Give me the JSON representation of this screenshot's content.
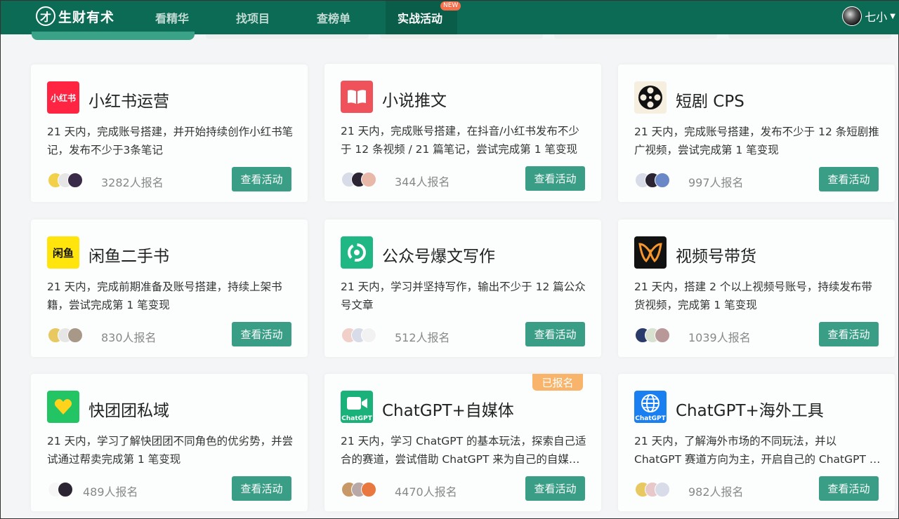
{
  "nav": {
    "logo_text": "生财有术",
    "logo_glyph": "才",
    "items": [
      "看精华",
      "找项目",
      "查榜单",
      "实战活动"
    ],
    "new_badge": "NEW",
    "user_name": "七小"
  },
  "colors": {
    "nav_bg": "#0c6b55",
    "button": "#3a9e86",
    "enrolled_badge": "#f7b46a"
  },
  "cards": [
    {
      "icon": "xiaohongshu-icon",
      "icon_text": "小红书",
      "title": "小红书运营",
      "desc": "21 天内，完成账号搭建，并开始持续创作小红书笔记，发布不少于3条笔记",
      "count": "3282人报名",
      "button": "查看活动"
    },
    {
      "icon": "book-icon",
      "title": "小说推文",
      "desc": "21 天内，完成账号搭建，在抖音/小红书发布不少于 12 条视频 / 21 篇笔记，尝试完成第 1 笔变现",
      "count": "344人报名",
      "button": "查看活动"
    },
    {
      "icon": "film-reel-icon",
      "title": "短剧 CPS",
      "desc": "21 天内，完成账号搭建，发布不少于 12 条短剧推广视频，尝试完成第 1 笔变现",
      "count": "997人报名",
      "button": "查看活动"
    },
    {
      "icon": "xianyu-icon",
      "icon_text": "闲鱼",
      "title": "闲鱼二手书",
      "desc": "21 天内，完成前期准备及账号搭建，持续上架书籍，尝试完成第 1 笔变现",
      "count": "830人报名",
      "button": "查看活动"
    },
    {
      "icon": "wechat-official-icon",
      "title": "公众号爆文写作",
      "desc": "21 天内，学习并坚持写作，输出不少于 12 篇公众号文章",
      "count": "512人报名",
      "button": "查看活动"
    },
    {
      "icon": "wechat-channels-icon",
      "title": "视频号带货",
      "desc": "21 天内，搭建 2 个以上视频号账号，持续发布带货视频，完成第 1 笔变现",
      "count": "1039人报名",
      "button": "查看活动"
    },
    {
      "icon": "kuaituantuan-icon",
      "title": "快团团私域",
      "desc": "21 天内，学习了解快团团不同角色的优劣势，并尝试通过帮卖完成第 1 笔变现",
      "count": "489人报名",
      "button": "查看活动"
    },
    {
      "icon": "chatgpt-video-icon",
      "icon_text": "ChatGPT",
      "title": "ChatGPT+自媒体",
      "desc": "21 天内，学习 ChatGPT 的基本玩法，探索自己适合的赛道，尝试借助 ChatGPT 来为自己的自媒体赋能",
      "count": "4470人报名",
      "button": "查看活动",
      "badge": "已报名"
    },
    {
      "icon": "chatgpt-globe-icon",
      "icon_text": "ChatGPT",
      "title": "ChatGPT+海外工具",
      "desc": "21 天内，了解海外市场的不同玩法，并以 ChatGPT 赛道方向为主，开启自己的 ChatGPT 海外之路",
      "count": "982人报名",
      "button": "查看活动"
    }
  ]
}
